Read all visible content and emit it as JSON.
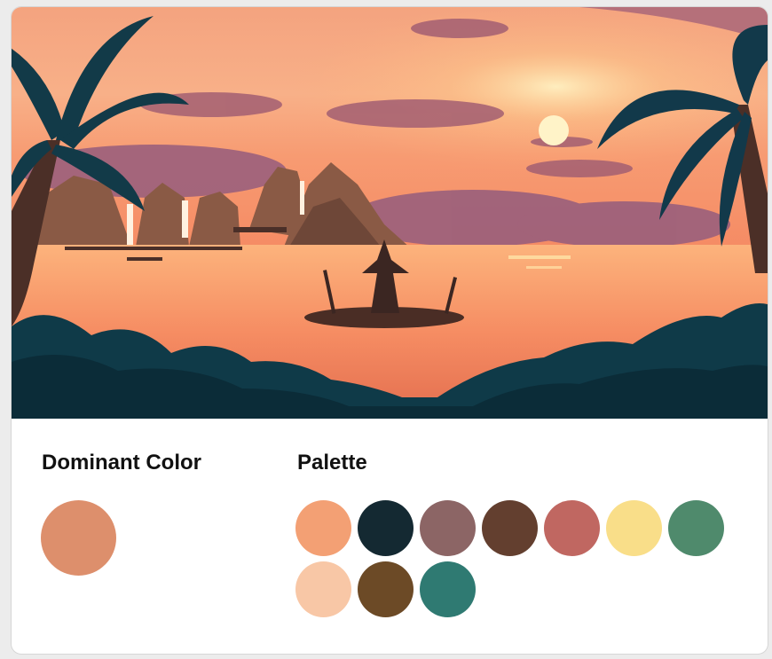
{
  "image": {
    "description_icon": "sunset-lagoon-illustration"
  },
  "dominant": {
    "title": "Dominant Color",
    "color": "#dd8f6c"
  },
  "palette": {
    "title": "Palette",
    "colors": [
      "#f3a074",
      "#142932",
      "#8c6565",
      "#633f2f",
      "#c06761",
      "#f9de89",
      "#4f8a6c",
      "#f8c7a6",
      "#6c4a26",
      "#2f7a72"
    ]
  }
}
